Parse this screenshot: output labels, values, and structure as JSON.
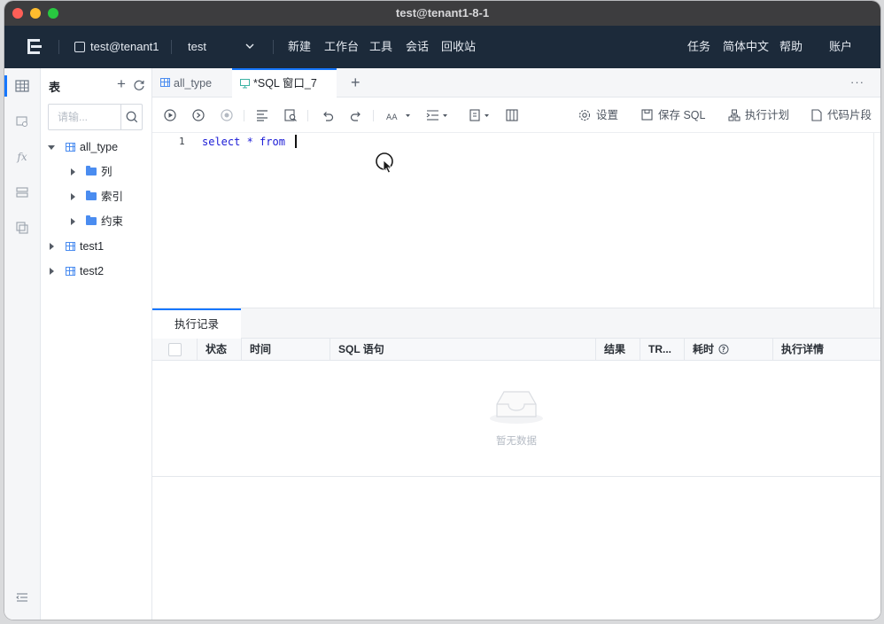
{
  "window": {
    "title": "test@tenant1-8-1"
  },
  "topbar": {
    "connection_label": "test@tenant1",
    "database_value": "test",
    "menu": [
      "新建",
      "工作台",
      "工具",
      "会话",
      "回收站"
    ],
    "right_menu": [
      "任务",
      "简体中文",
      "帮助",
      "账户"
    ]
  },
  "tree_panel": {
    "title": "表",
    "search_placeholder": "请输...",
    "tables": [
      {
        "label": "all_type",
        "expanded": true,
        "children": [
          "列",
          "索引",
          "约束"
        ]
      },
      {
        "label": "test1",
        "expanded": false
      },
      {
        "label": "test2",
        "expanded": false
      }
    ]
  },
  "tabs": [
    {
      "label": "all_type",
      "icon": "table-icon",
      "active": false
    },
    {
      "label": "*SQL 窗口_7",
      "icon": "sql-window-icon",
      "active": true
    }
  ],
  "toolbar": {
    "settings_label": "设置",
    "save_sql_label": "保存 SQL",
    "exec_plan_label": "执行计划",
    "snippet_label": "代码片段"
  },
  "editor": {
    "line_number": "1",
    "code": "select * from "
  },
  "bottom": {
    "tab_label": "执行记录",
    "columns": [
      "状态",
      "时间",
      "SQL 语句",
      "结果",
      "TR...",
      "耗时",
      "执行详情"
    ],
    "empty_text": "暂无数据"
  },
  "colors": {
    "accent": "#1677ff",
    "topbar_bg": "#1c2a3a",
    "keyword": "#1a1ad6"
  }
}
